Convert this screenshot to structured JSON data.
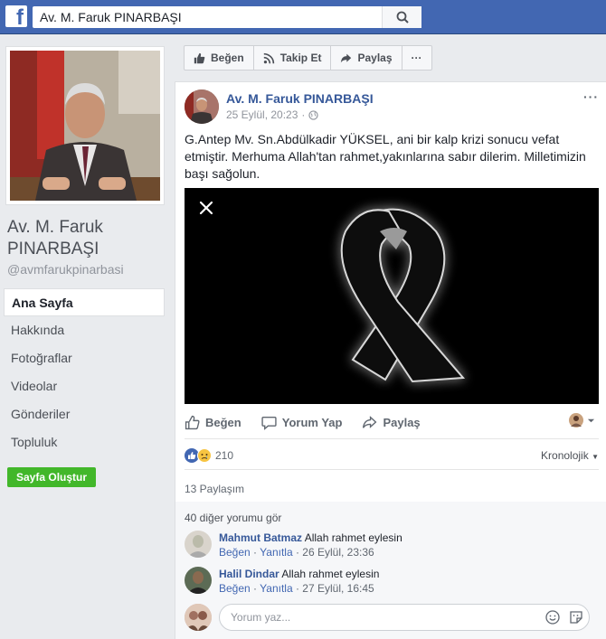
{
  "search": {
    "value": "Av. M. Faruk PINARBAŞI"
  },
  "page": {
    "name": "Av. M. Faruk PINARBAŞI",
    "handle": "@avmfarukpinarbasi"
  },
  "nav": [
    {
      "label": "Ana Sayfa"
    },
    {
      "label": "Hakkında"
    },
    {
      "label": "Fotoğraflar"
    },
    {
      "label": "Videolar"
    },
    {
      "label": "Gönderiler"
    },
    {
      "label": "Topluluk"
    }
  ],
  "create_page_label": "Sayfa Oluştur",
  "actions": {
    "like": "Beğen",
    "follow": "Takip Et",
    "share": "Paylaş",
    "more": "···"
  },
  "post": {
    "author": "Av. M. Faruk PINARBAŞI",
    "date": "25 Eylül, 20:23",
    "more": "···",
    "text": "G.Antep Mv. Sn.Abdülkadir YÜKSEL, ani bir kalp krizi sonucu vefat etmiştir. Merhuma Allah'tan rahmet,yakınlarına sabır dilerim. Milletimizin başı sağolun.",
    "buttons": {
      "like": "Beğen",
      "comment": "Yorum Yap",
      "share": "Paylaş"
    },
    "reaction_count": "210",
    "sort": "Kronolojik",
    "shares": "13 Paylaşım",
    "more_comments": "40 diğer yorumu gör"
  },
  "comments": [
    {
      "name": "Mahmut Batmaz",
      "text": "Allah rahmet eylesin",
      "like": "Beğen",
      "reply": "Yanıtla",
      "time": "26 Eylül, 23:36"
    },
    {
      "name": "Halil Dindar",
      "text": "Allah rahmet eylesin",
      "like": "Beğen",
      "reply": "Yanıtla",
      "time": "27 Eylül, 16:45"
    }
  ],
  "compose": {
    "placeholder": "Yorum yaz..."
  },
  "colors": {
    "brand": "#4267b2",
    "link": "#365899",
    "create_button": "#42b72a",
    "ribbon": "#111111"
  }
}
